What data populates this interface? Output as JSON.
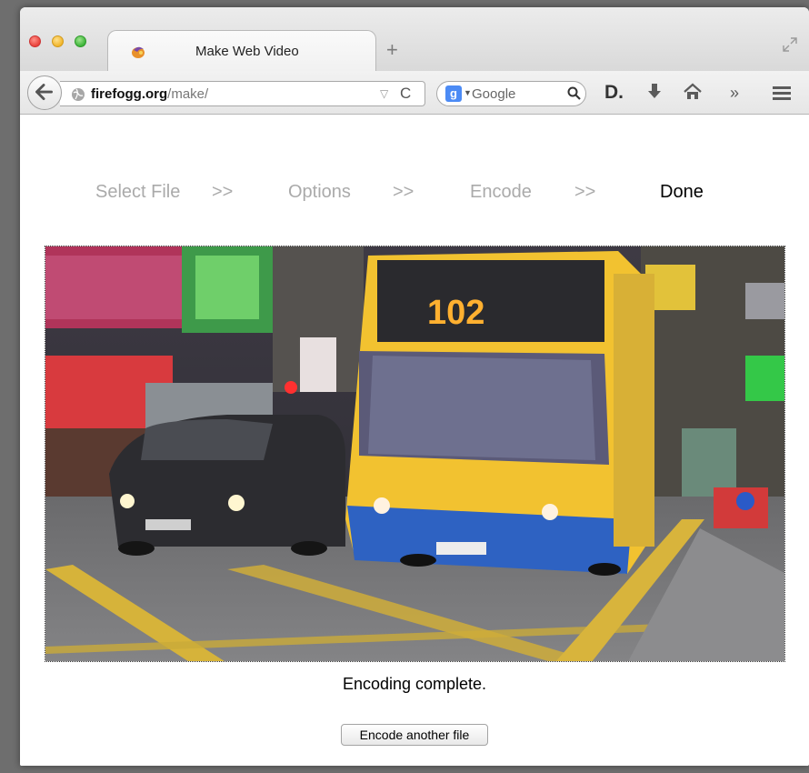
{
  "browser": {
    "tab": {
      "title": "Make Web Video",
      "favicon": "firefogg-icon"
    },
    "new_tab_label": "+",
    "url": {
      "domain": "firefogg.org",
      "path": "/make/"
    },
    "search": {
      "engine": "Google",
      "placeholder": "Google"
    },
    "toolbar": {
      "d_label": "D.",
      "overflow_label": "»"
    }
  },
  "steps": [
    {
      "label": "Select File",
      "active": false
    },
    {
      "label": "Options",
      "active": false
    },
    {
      "label": "Encode",
      "active": false
    },
    {
      "label": "Done",
      "active": true
    }
  ],
  "separator": ">>",
  "video": {
    "bus_sign": "102"
  },
  "status": {
    "message": "Encoding complete."
  },
  "actions": {
    "encode_another_label": "Encode another file"
  },
  "colors": {
    "active_step": "#000000",
    "inactive_step": "#aaaaaa",
    "bus_yellow": "#f2c230",
    "bus_blue": "#2e62c2"
  }
}
